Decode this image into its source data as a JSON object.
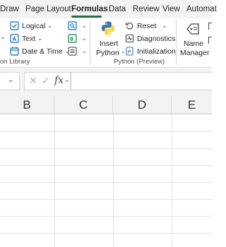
{
  "tabs": [
    {
      "label": "Draw",
      "active": false
    },
    {
      "label": "Page Layout",
      "active": false
    },
    {
      "label": "Formulas",
      "active": true
    },
    {
      "label": "Data",
      "active": false
    },
    {
      "label": "Review",
      "active": false
    },
    {
      "label": "View",
      "active": false
    },
    {
      "label": "Automat",
      "active": false
    }
  ],
  "ribbon": {
    "function_library": {
      "group_label": "on Library",
      "logical": "Logical",
      "text": "Text",
      "date_time": "Date & Time"
    },
    "python": {
      "insert_line1": "Insert",
      "insert_line2": "Python",
      "reset": "Reset",
      "diagnostics": "Diagnostics",
      "initialization": "Initialization",
      "group_label": "Python (Preview)"
    },
    "names": {
      "name_line1": "Name",
      "name_line2": "Manager"
    }
  },
  "formula_bar": {
    "fx": "fx",
    "value": ""
  },
  "columns": [
    "B",
    "C",
    "D",
    "E"
  ],
  "colors": {
    "accent": "#217346",
    "python_blue": "#3776ab",
    "python_yellow": "#ffd43b"
  }
}
